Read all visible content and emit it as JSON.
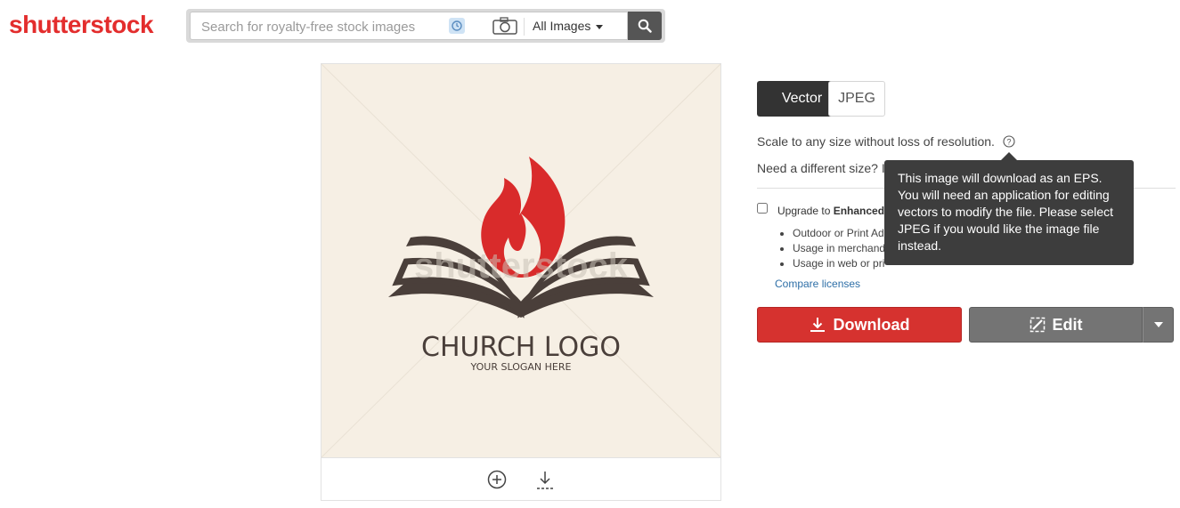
{
  "header": {
    "logo_text": "shutterstock",
    "search_placeholder": "Search for royalty-free stock images",
    "filter_label": "All Images",
    "icons": [
      "reverse-search-icon",
      "camera-icon",
      "search-icon"
    ]
  },
  "preview": {
    "logo_title": "CHURCH LOGO",
    "logo_slogan": "YOUR SLOGAN HERE",
    "watermark": "shutterstock",
    "icons": [
      "zoom-in-icon",
      "download-icon"
    ]
  },
  "formats": {
    "vector_label": "Vector",
    "jpeg_label": "JPEG",
    "selected": "Vector"
  },
  "info": {
    "scale_text": "Scale to any size without loss of resolution.",
    "need_size": "Need a different size? I"
  },
  "license": {
    "upgrade_prefix": "Upgrade to ",
    "upgrade_bold": "Enhanced",
    "uses": [
      "Outdoor or Print Ad",
      "Usage in merchand",
      "Usage in web or pri"
    ],
    "compare_label": "Compare licenses"
  },
  "actions": {
    "download_label": "Download",
    "edit_label": "Edit"
  },
  "tooltip": {
    "text": "This image will download as an EPS. You will need an application for editing vectors to modify the file. Please select JPEG if you would like the image file instead."
  },
  "colors": {
    "brand_red": "#e32d2d",
    "download_red": "#d6322f",
    "edit_gray": "#747474",
    "selected_dark": "#333333",
    "flame_red": "#d92b2b",
    "book_dark": "#4a3f3a"
  }
}
